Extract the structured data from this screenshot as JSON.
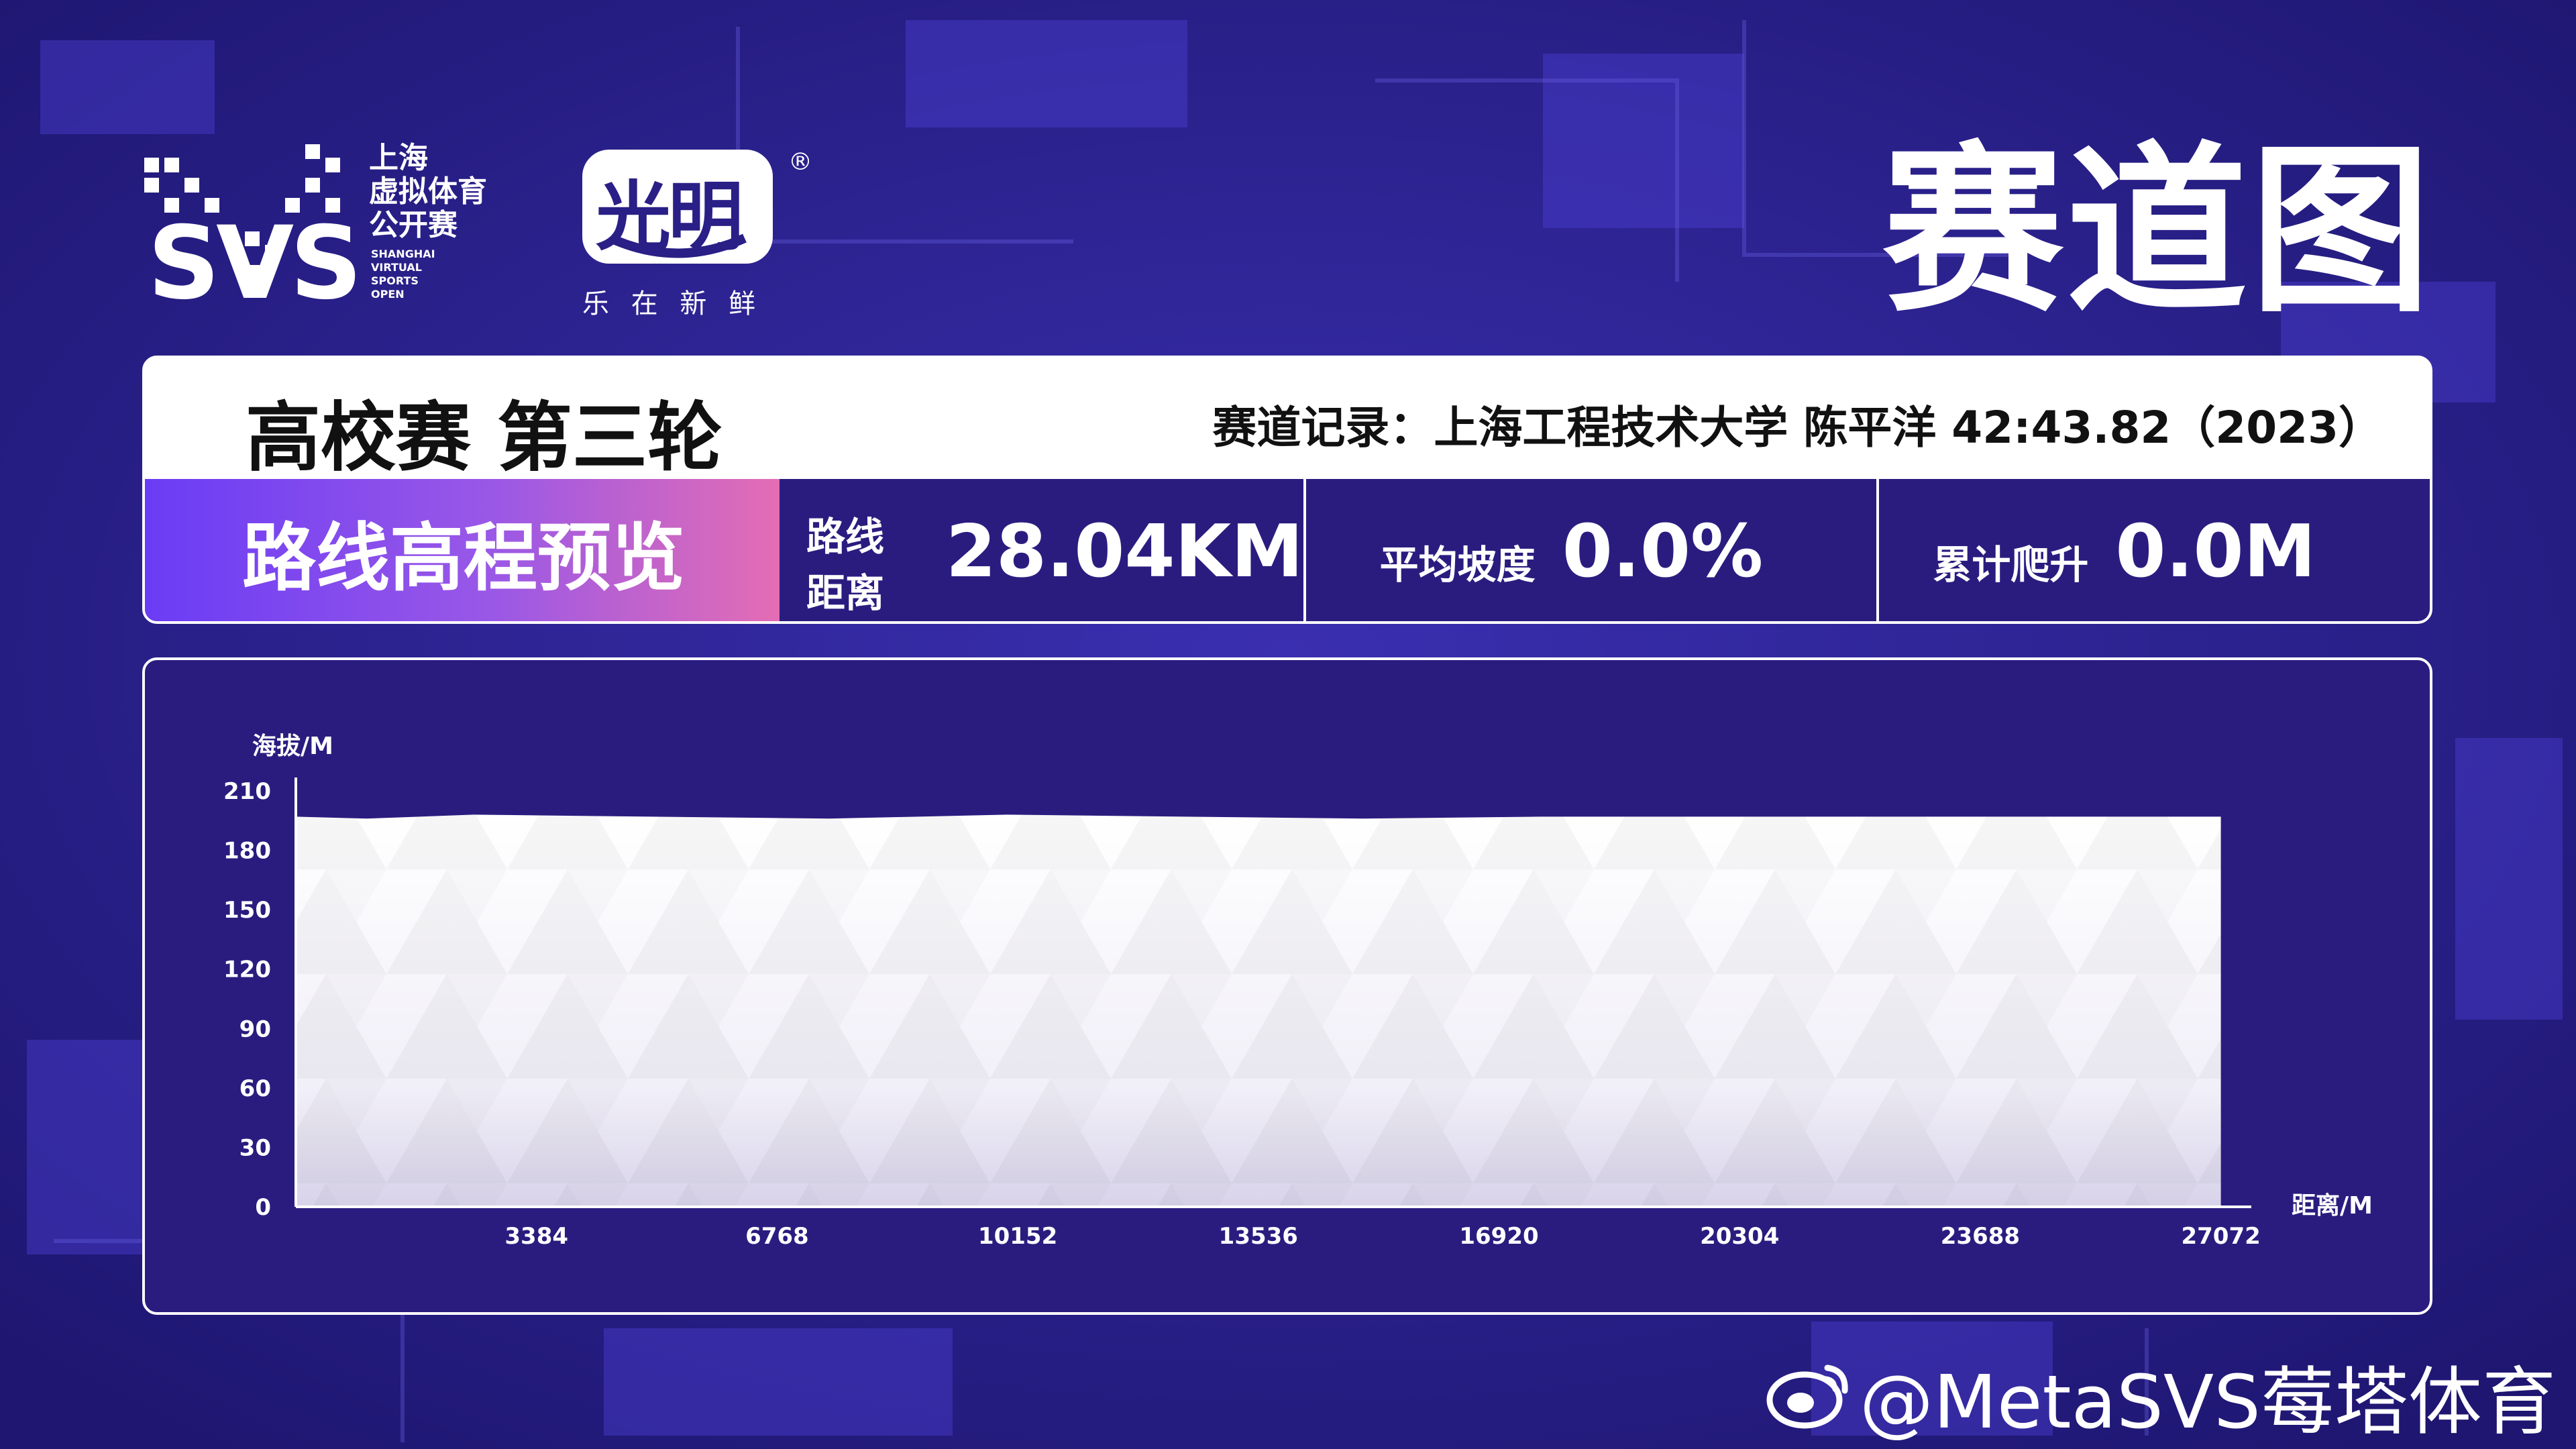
{
  "header": {
    "svs_logo": {
      "line1": "上海",
      "line2": "虚拟体育",
      "line3": "公开赛",
      "en1": "SHANGHAI",
      "en2": "VIRTUAL",
      "en3": "SPORTS",
      "en4": "OPEN",
      "mark": "SVS"
    },
    "brand_logo": {
      "name": "光明",
      "registered": "®",
      "slogan": "乐 在 新 鲜"
    },
    "page_title": "赛道图"
  },
  "race": {
    "name": "高校赛 第三轮",
    "record": "赛道记录：上海工程技术大学 陈平洋 42:43.82（2023）"
  },
  "stats": {
    "section_label": "路线高程预览",
    "distance_label": "路线距离",
    "distance_value": "28.04KM",
    "slope_label": "平均坡度",
    "slope_value": "0.0%",
    "climb_label": "累计爬升",
    "climb_value": "0.0M"
  },
  "chart_data": {
    "type": "area",
    "ylabel": "海拔/M",
    "xlabel": "距离/M",
    "y_ticks": [
      "0",
      "30",
      "60",
      "90",
      "120",
      "150",
      "180",
      "210"
    ],
    "x_ticks": [
      "3384",
      "6768",
      "10152",
      "13536",
      "16920",
      "20304",
      "23688",
      "27072"
    ],
    "ylim": [
      0,
      210
    ],
    "xlim": [
      0,
      27500
    ],
    "grid": false,
    "series": [
      {
        "x": [
          0,
          1000,
          2500,
          5000,
          7500,
          10000,
          12500,
          15000,
          17500,
          20000,
          22500,
          25000,
          27072
        ],
        "values": [
          197,
          196,
          198,
          197,
          196,
          198,
          197,
          196,
          197,
          197,
          197,
          197,
          197
        ]
      }
    ],
    "colors": {
      "fill_top": "#ffffff",
      "fill_bottom": "#d8d3ea",
      "axis": "#ffffff",
      "text": "#ffffff"
    }
  },
  "watermark": {
    "icon": "weibo-icon",
    "text": "@MetaSVS莓塔体育"
  },
  "colors": {
    "background": "#2a1f86",
    "panel_dark": "#2a1c7f",
    "accent_gradient_start": "#6a3cf5",
    "accent_gradient_end": "#e46db4"
  }
}
